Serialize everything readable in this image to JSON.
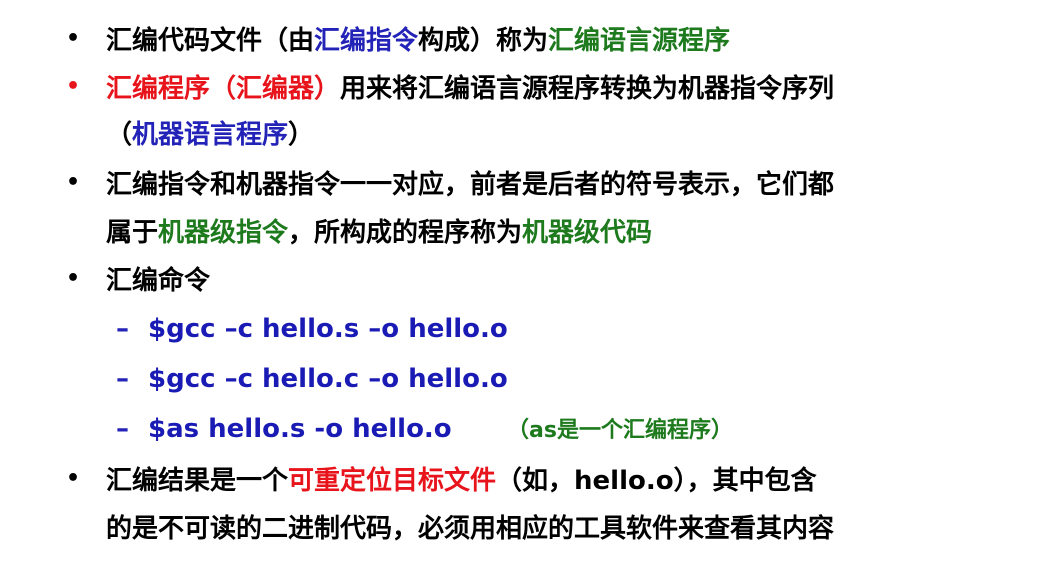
{
  "colors": {
    "red": "#e8141c",
    "blue": "#2323b8",
    "green": "#1d7a1d",
    "black": "#000000"
  },
  "b1": {
    "bullet": "•",
    "t1": "汇编代码文件（由",
    "t2": "汇编指令",
    "t3": "构成）称为",
    "t4": "汇编语言源程序"
  },
  "b2": {
    "bullet": "•",
    "t1": "汇编程序（汇编器）",
    "t2": "用来将汇编语言源程序转换为机器指令序列",
    "l2_open": "（",
    "l2_mid": "机器语言程序",
    "l2_close": "）"
  },
  "b3": {
    "bullet": "•",
    "line1": "汇编指令和机器指令一一对应，前者是后者的符号表示，它们都",
    "l2a": "属于",
    "l2b": "机器级指令",
    "l2c": "，所构成的程序称为",
    "l2d": "机器级代码"
  },
  "b4": {
    "bullet": "•",
    "title": "汇编命令",
    "dash": "–",
    "cmd1": "$gcc –c hello.s –o hello.o",
    "cmd2": "$gcc –c hello.c –o hello.o",
    "cmd3": "$as hello.s -o hello.o",
    "note": "（as是一个汇编程序）"
  },
  "b5": {
    "bullet": "•",
    "t1": "汇编结果是一个",
    "t2": "可重定位目标文件",
    "t3": "（如，hello.o），其中包含",
    "line2": "的是不可读的二进制代码，必须用相应的工具软件来查看其内容"
  }
}
